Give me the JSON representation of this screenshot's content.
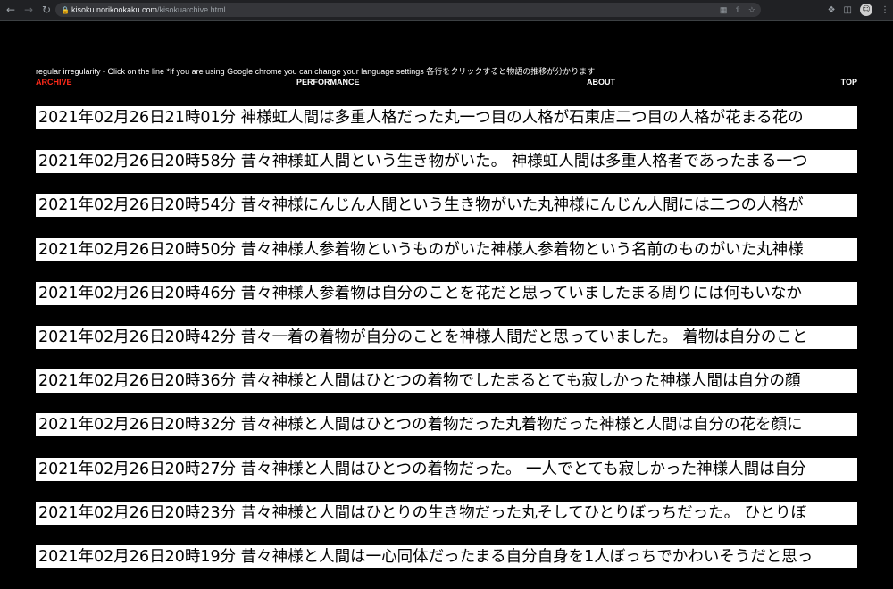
{
  "browser": {
    "url_domain": "kisoku.norikookaku.com",
    "url_path": "/kisokuarchive.html"
  },
  "page": {
    "tagline": "regular irregularity - Click on the line *If you are using Google chrome you can change your language settings 各行をクリックすると物語の推移が分かります",
    "nav": {
      "archive": "ARCHIVE",
      "performance": "PERFORMANCE",
      "about": "ABOUT",
      "top": "TOP"
    },
    "colors": {
      "active_nav": "#ff2a1a",
      "background": "#000000",
      "entry_bg": "#ffffff"
    },
    "entries": [
      "2021年02月26日21時01分 神様虹人間は多重人格だった丸一つ目の人格が石東店二つ目の人格が花まる花の",
      "2021年02月26日20時58分 昔々神様虹人間という生き物がいた。 神様虹人間は多重人格者であったまる一つ",
      "2021年02月26日20時54分 昔々神様にんじん人間という生き物がいた丸神様にんじん人間には二つの人格が",
      "2021年02月26日20時50分 昔々神様人参着物というものがいた神様人参着物という名前のものがいた丸神様",
      "2021年02月26日20時46分 昔々神様人参着物は自分のことを花だと思っていましたまる周りには何もいなか",
      "2021年02月26日20時42分 昔々一着の着物が自分のことを神様人間だと思っていました。 着物は自分のこと",
      "2021年02月26日20時36分 昔々神様と人間はひとつの着物でしたまるとても寂しかった神様人間は自分の顔",
      "2021年02月26日20時32分 昔々神様と人間はひとつの着物だった丸着物だった神様と人間は自分の花を顔に",
      "2021年02月26日20時27分 昔々神様と人間はひとつの着物だった。 一人でとても寂しかった神様人間は自分",
      "2021年02月26日20時23分 昔々神様と人間はひとりの生き物だった丸そしてひとりぼっちだった。 ひとりぼ",
      "2021年02月26日20時19分 昔々神様と人間は一心同体だったまる自分自身を1人ぼっちでかわいそうだと思っ"
    ]
  }
}
